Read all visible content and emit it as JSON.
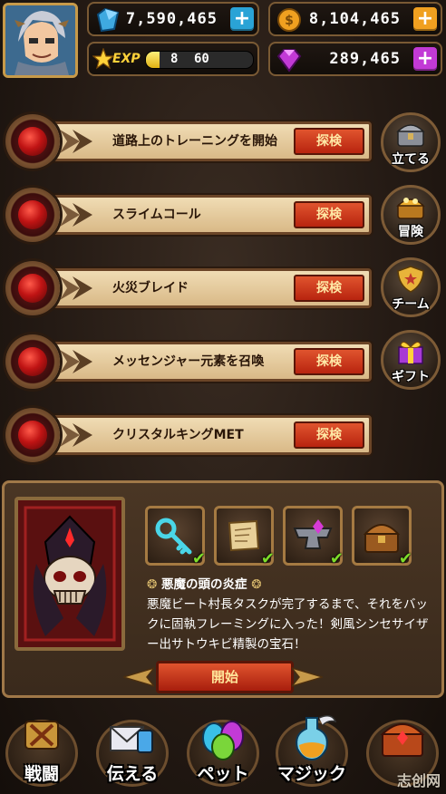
{
  "resources": {
    "crystals": "7,590,465",
    "coins": "8,104,465",
    "gems": "289,465",
    "exp_label": "EXP",
    "exp_current": "8",
    "exp_max": "60",
    "exp_progress": 0.13
  },
  "quests": [
    {
      "title": "道路上のトレーニングを開始",
      "button": "探検"
    },
    {
      "title": "スライムコール",
      "button": "探検"
    },
    {
      "title": "火災ブレイド",
      "button": "探検"
    },
    {
      "title": "メッセンジャー元素を召喚",
      "button": "探検"
    },
    {
      "title": "クリスタルキングMET",
      "button": "探検"
    }
  ],
  "side_menu": [
    {
      "label": "立てる",
      "icon": "chest-icon"
    },
    {
      "label": "冒険",
      "icon": "treasure-icon"
    },
    {
      "label": "チーム",
      "icon": "shield-icon"
    },
    {
      "label": "ギフト",
      "icon": "gift-icon"
    }
  ],
  "detail": {
    "title": "悪魔の頭の炎症",
    "description": "悪魔ビート村長タスクが完了するまで、それをバックに固執フレーミングに入った！剣風シンセサイザー出サトウキビ精製の宝石！",
    "start_button": "開始",
    "rewards": [
      {
        "icon": "key-icon",
        "done": true
      },
      {
        "icon": "scroll-icon",
        "done": true
      },
      {
        "icon": "anvil-icon",
        "done": true
      },
      {
        "icon": "treasure-chest-icon",
        "done": true
      }
    ]
  },
  "bottom_nav": [
    {
      "label": "戦闘",
      "icon": "battle-icon"
    },
    {
      "label": "伝える",
      "icon": "letter-icon"
    },
    {
      "label": "ペット",
      "icon": "egg-icon"
    },
    {
      "label": "マジック",
      "icon": "potion-icon"
    },
    {
      "label": "",
      "icon": "chest-icon"
    }
  ],
  "watermark": "志创网",
  "colors": {
    "accent": "#c01414",
    "gold": "#c79a4a",
    "plus_blue": "#2aa3d6",
    "plus_orange": "#f0a020",
    "plus_purple": "#c23ad6"
  }
}
